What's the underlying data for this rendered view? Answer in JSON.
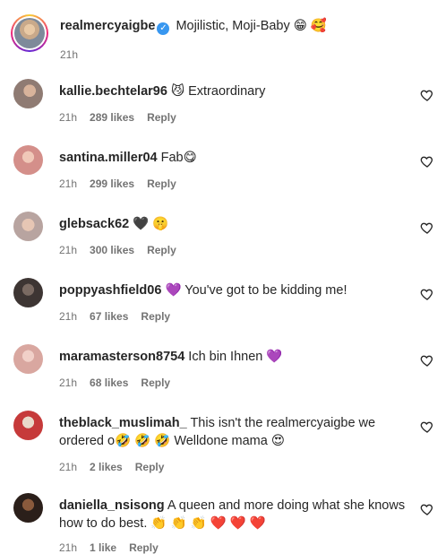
{
  "caption": {
    "username": "realmercyaigbe",
    "text": "Mojilistic, Moji-Baby 😁 🥰",
    "time": "21h"
  },
  "comments": [
    {
      "username": "kallie.bechtelar96",
      "text": "😼 Extraordinary",
      "time": "21h",
      "likes": "289 likes",
      "reply": "Reply"
    },
    {
      "username": "santina.miller04",
      "text": "Fab😋",
      "time": "21h",
      "likes": "299 likes",
      "reply": "Reply"
    },
    {
      "username": "glebsack62",
      "text": "🖤 🤫",
      "time": "21h",
      "likes": "300 likes",
      "reply": "Reply"
    },
    {
      "username": "poppyashfield06",
      "text": "💜 You've got to be kidding me!",
      "time": "21h",
      "likes": "67 likes",
      "reply": "Reply"
    },
    {
      "username": "maramasterson8754",
      "text": "Ich bin Ihnen 💜",
      "time": "21h",
      "likes": "68 likes",
      "reply": "Reply"
    },
    {
      "username": "theblack_muslimah_",
      "text": "This isn't the realmercyaigbe we ordered o🤣 🤣 🤣 Welldone mama 😍",
      "time": "21h",
      "likes": "2 likes",
      "reply": "Reply"
    },
    {
      "username": "daniella_nsisong",
      "text": "A queen and more doing what she knows how to do best. 👏 👏 👏 ❤️ ❤️ ❤️",
      "time": "21h",
      "likes": "1 like",
      "reply": "Reply"
    }
  ],
  "icons": {
    "verified": "verified-badge-icon",
    "like": "heart-outline-icon"
  },
  "colors": {
    "verified": "#3897f0",
    "meta": "#737373",
    "text": "#262626"
  }
}
